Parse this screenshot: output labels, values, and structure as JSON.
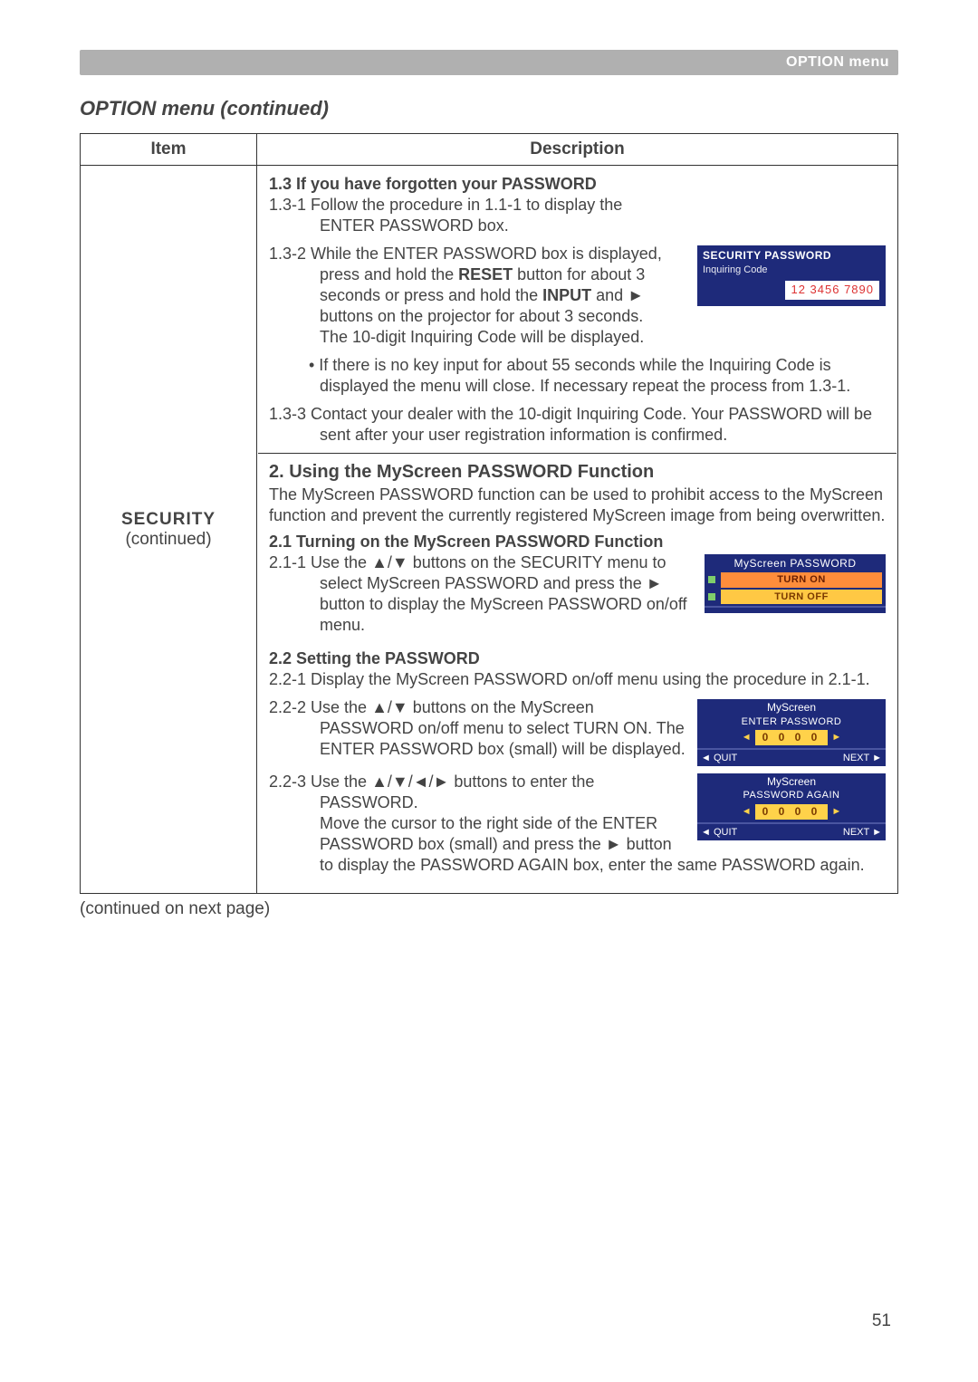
{
  "header": {
    "label": "OPTION menu"
  },
  "section_title": "OPTION menu (continued)",
  "table": {
    "headers": {
      "item": "Item",
      "description": "Description"
    },
    "item": {
      "name": "SECURITY",
      "note": "(continued)"
    },
    "desc": {
      "s1_3": {
        "heading": "1.3 If you have forgotten your PASSWORD",
        "p1_a": "1.3-1 Follow the procedure in 1.1-1 to display the",
        "p1_b": "ENTER PASSWORD box.",
        "p2_lead": "1.3-2 While the ENTER PASSWORD box is displayed, press and hold the ",
        "p2_reset": "RESET",
        "p2_mid": " button for about 3 seconds or press and hold the ",
        "p2_input": "INPUT",
        "p2_tail": " and ► buttons on the projector for about 3 seconds.",
        "p2_line2": "The 10-digit Inquiring Code will be displayed.",
        "p2_bullet": "• If there is no key input for about 55 seconds while the Inquiring Code is displayed the menu will close. If necessary repeat the process from 1.3-1.",
        "p3": "1.3-3 Contact your dealer with the 10-digit Inquiring Code. Your PASSWORD will be sent after your user registration information is confirmed."
      },
      "s2": {
        "heading": "2. Using the MyScreen PASSWORD Function",
        "intro": "The MyScreen PASSWORD function can be used to prohibit access to the MyScreen function and prevent the currently registered MyScreen image from being overwritten.",
        "s2_1_heading": "2.1 Turning on the MyScreen PASSWORD Function",
        "s2_1_p": "2.1-1 Use the ▲/▼ buttons on the SECURITY menu to select MyScreen PASSWORD and press the ► button to display the MyScreen PASSWORD on/off menu.",
        "s2_2_heading": "2.2 Setting the PASSWORD",
        "s2_2_p1": "2.2-1 Display the MyScreen PASSWORD on/off menu using the procedure in 2.1-1.",
        "s2_2_p2": "2.2-2 Use the ▲/▼ buttons on the MyScreen PASSWORD on/off menu to select TURN ON. The ENTER PASSWORD box (small) will be displayed.",
        "s2_2_p3": "2.2-3 Use the ▲/▼/◄/► buttons to enter the PASSWORD.",
        "s2_2_p3b": "Move the cursor to the right side of the ENTER PASSWORD box (small) and press the ► button to display the PASSWORD AGAIN box, enter the same PASSWORD again."
      }
    }
  },
  "figures": {
    "secpass": {
      "title": "SECURITY PASSWORD",
      "sub": "Inquiring Code",
      "code": "12 3456 7890"
    },
    "myscreen_menu": {
      "title": "MyScreen PASSWORD",
      "on": "TURN ON",
      "off": "TURN OFF"
    },
    "enter_pw": {
      "line1": "MyScreen",
      "line2": "ENTER PASSWORD",
      "digits": "0 0 0 0",
      "quit": "◄ QUIT",
      "next": "NEXT ►"
    },
    "pw_again": {
      "line1": "MyScreen",
      "line2": "PASSWORD AGAIN",
      "digits": "0 0 0 0",
      "quit": "◄ QUIT",
      "next": "NEXT ►"
    }
  },
  "footer": {
    "continued": "(continued on next page)",
    "page": "51"
  }
}
